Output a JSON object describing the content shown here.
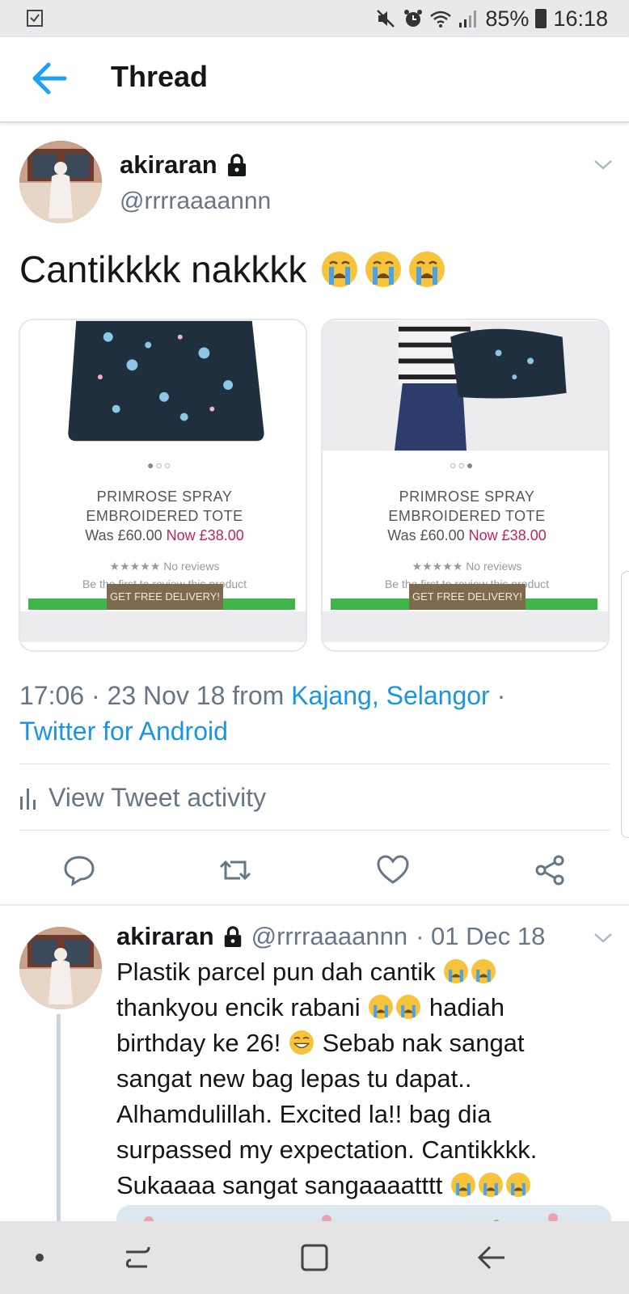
{
  "status_bar": {
    "battery": "85%",
    "time": "16:18",
    "icons": [
      "task-icon",
      "mute-icon",
      "alarm-icon",
      "wifi-icon",
      "signal-icon",
      "battery-icon"
    ]
  },
  "app_bar": {
    "back_icon": "back-arrow-icon",
    "title": "Thread"
  },
  "main_tweet": {
    "display_name": "akiraran",
    "handle": "@rrrraaaannn",
    "text": "Cantikkkk nakkkk",
    "emojis": [
      "crying-face",
      "crying-face",
      "crying-face"
    ],
    "media": [
      {
        "dots": "●○○",
        "product_name_line1": "PRIMROSE SPRAY",
        "product_name_line2": "EMBROIDERED TOTE",
        "was": "Was £60.00",
        "now": "Now £38.00",
        "reviews": "★★★★★ No reviews",
        "first_review": "Be the first to review this product",
        "delivery_button": "GET FREE DELIVERY!"
      },
      {
        "dots": "○○●",
        "product_name_line1": "PRIMROSE SPRAY",
        "product_name_line2": "EMBROIDERED TOTE",
        "was": "Was £60.00",
        "now": "Now £38.00",
        "reviews": "★★★★★ No reviews",
        "first_review": "Be the first to review this product",
        "delivery_button": "GET FREE DELIVERY!"
      }
    ],
    "timestamp": "17:06 · 23 Nov 18 from",
    "location": "Kajang, Selangor",
    "separator": "·",
    "client": "Twitter for Android",
    "activity_label": "View Tweet activity",
    "actions": [
      "reply-icon",
      "retweet-icon",
      "like-icon",
      "share-icon"
    ]
  },
  "reply_tweet": {
    "display_name": "akiraran",
    "handle": "@rrrraaaannn",
    "date": "· 01 Dec 18",
    "lines": [
      "Plastik parcel pun dah cantik",
      "thankyou encik rabani",
      "hadiah",
      "birthday ke 26!",
      "Sebab nak sangat",
      "sangat new bag lepas tu dapat..",
      "Alhamdulillah. Excited la!! bag dia",
      "surpassed my expectation. Cantikkkk.",
      "Sukaaaa sangat sangaaaatttt"
    ]
  },
  "nav_bar": {
    "icons": [
      "dot-icon",
      "recents-icon",
      "home-icon",
      "back-icon"
    ]
  },
  "colors": {
    "accent": "#1b95e0",
    "secondary_text": "#657786",
    "price_now": "#c0245a",
    "delivery_green": "#3fb54a"
  }
}
